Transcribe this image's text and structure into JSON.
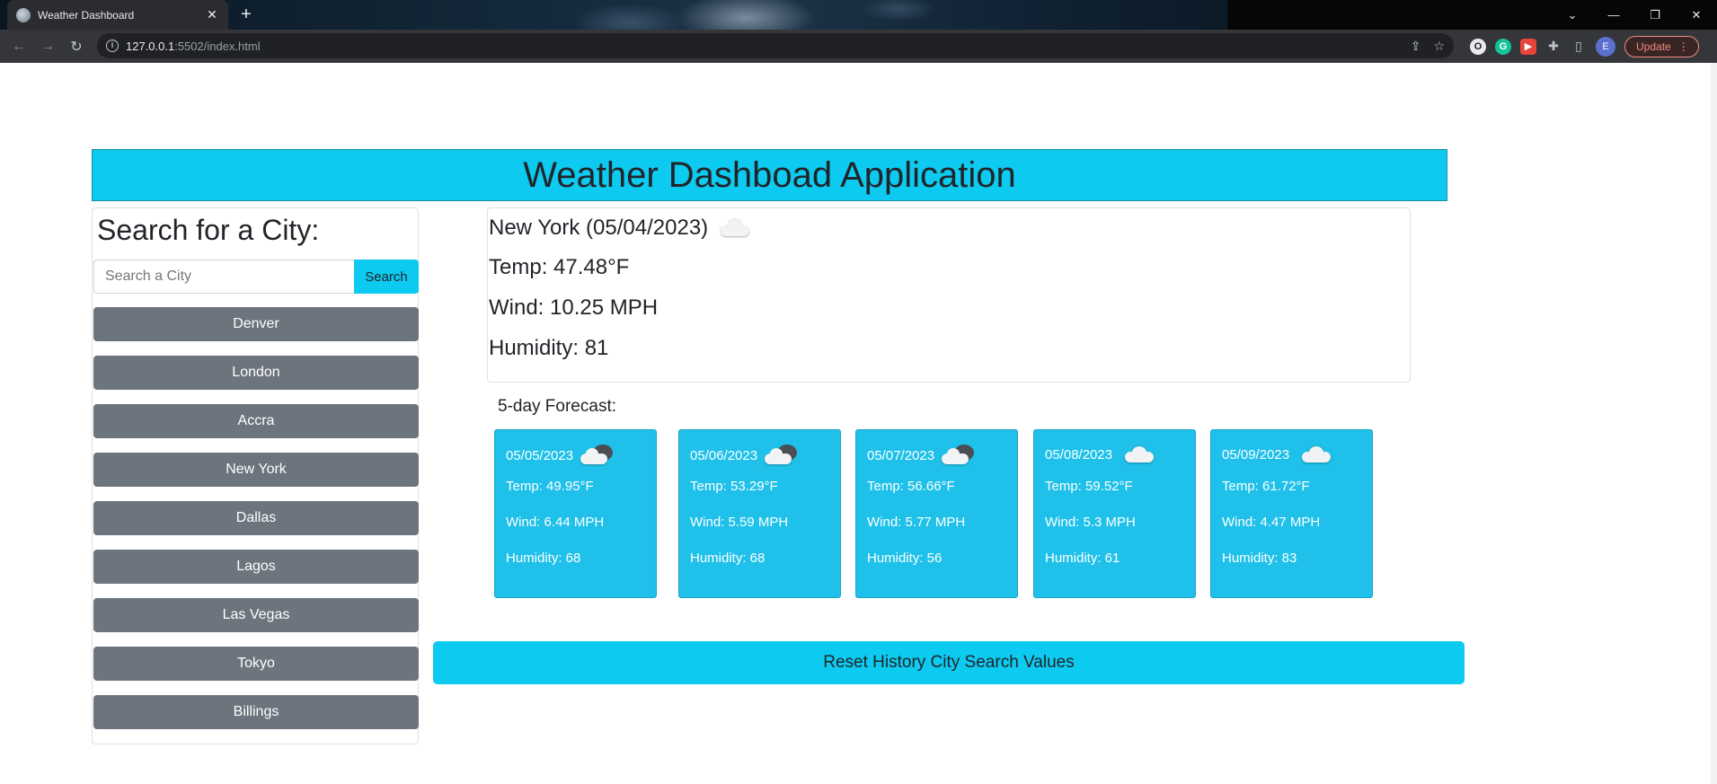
{
  "browser": {
    "tab_title": "Weather Dashboard",
    "url_host": "127.0.0.1",
    "url_path": ":5502/index.html",
    "update_label": "Update",
    "avatar_letter": "E"
  },
  "header": {
    "title": "Weather Dashboad Application"
  },
  "search": {
    "title": "Search for a City:",
    "placeholder": "Search a City",
    "button_label": "Search",
    "history": [
      "Denver",
      "London",
      "Accra",
      "New York",
      "Dallas",
      "Lagos",
      "Las Vegas",
      "Tokyo",
      "Billings"
    ]
  },
  "current": {
    "heading": "New York (05/04/2023)",
    "icon": "cloud-icon",
    "temp": "Temp: 47.48°F",
    "wind": "Wind: 10.25 MPH",
    "humidity": "Humidity: 81"
  },
  "forecast": {
    "title": "5-day Forecast:",
    "days": [
      {
        "date": "05/05/2023",
        "icon": "partly-cloudy-icon",
        "temp": "Temp: 49.95°F",
        "wind": "Wind: 6.44 MPH",
        "humidity": "Humidity: 68"
      },
      {
        "date": "05/06/2023",
        "icon": "partly-cloudy-icon",
        "temp": "Temp: 53.29°F",
        "wind": "Wind: 5.59 MPH",
        "humidity": "Humidity: 68"
      },
      {
        "date": "05/07/2023",
        "icon": "partly-cloudy-icon",
        "temp": "Temp: 56.66°F",
        "wind": "Wind: 5.77 MPH",
        "humidity": "Humidity: 56"
      },
      {
        "date": "05/08/2023",
        "icon": "cloud-icon",
        "temp": "Temp: 59.52°F",
        "wind": "Wind: 5.3 MPH",
        "humidity": "Humidity: 61"
      },
      {
        "date": "05/09/2023",
        "icon": "cloud-icon",
        "temp": "Temp: 61.72°F",
        "wind": "Wind: 4.47 MPH",
        "humidity": "Humidity: 83"
      }
    ]
  },
  "reset_label": "Reset History City Search Values",
  "colors": {
    "accent": "#0dcaf0",
    "card": "#1fc1ea",
    "history_button": "#6c757d"
  }
}
